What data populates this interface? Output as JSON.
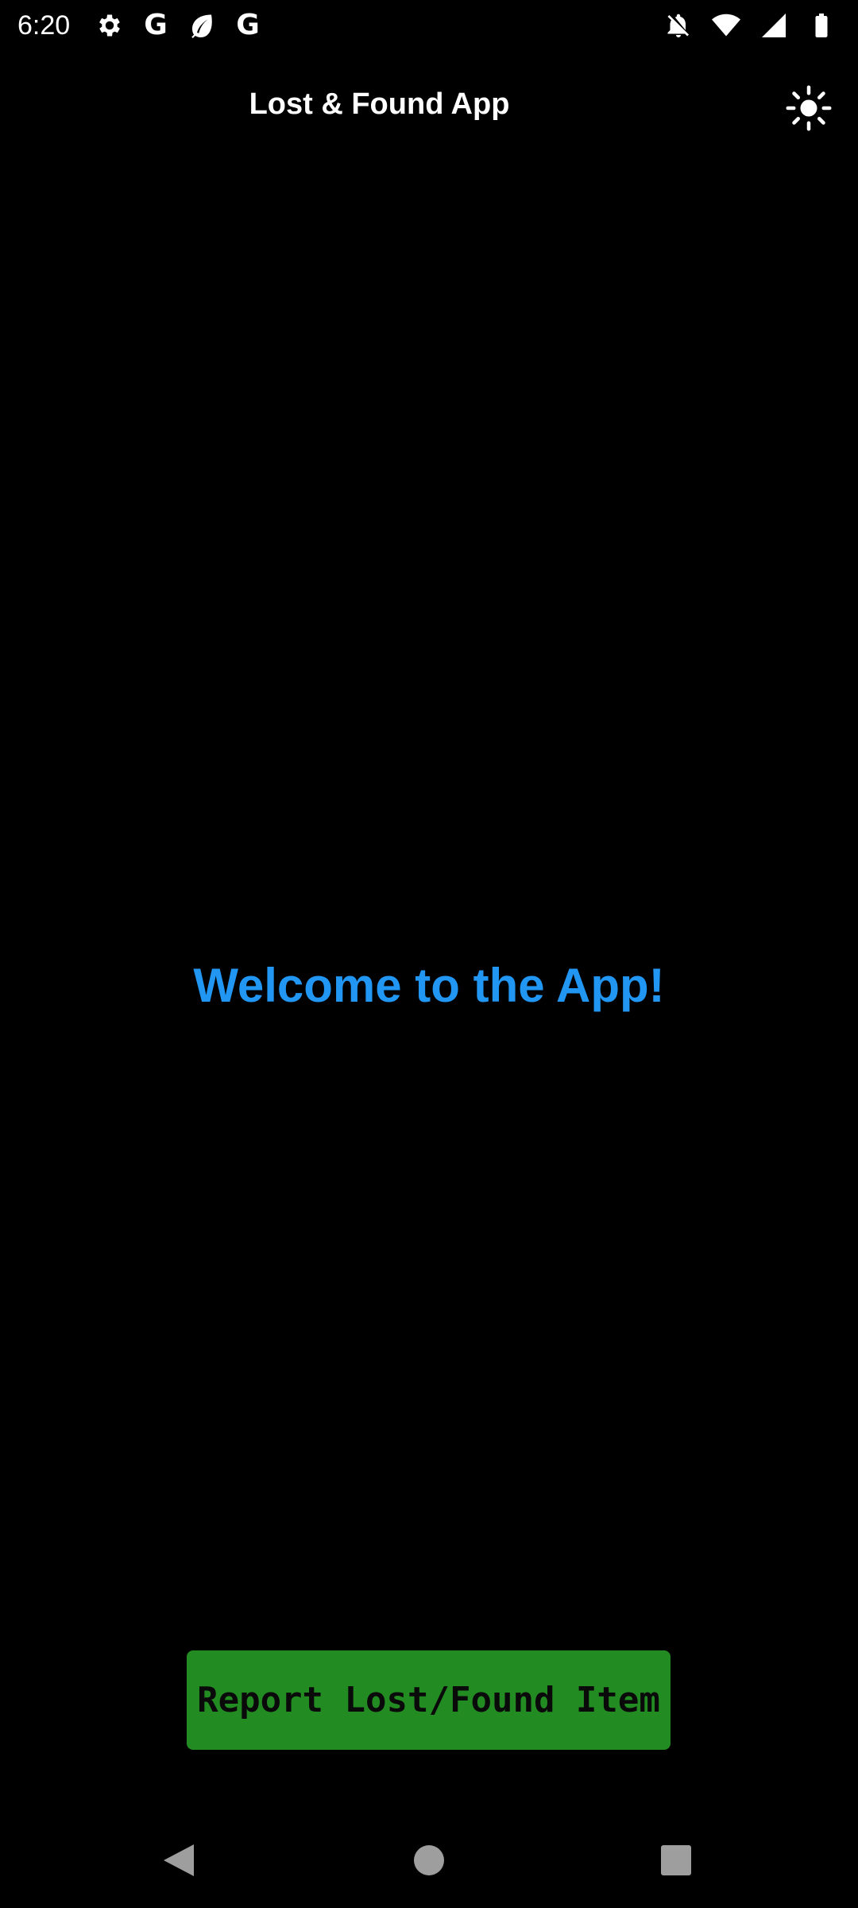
{
  "status_bar": {
    "time": "6:20",
    "left_icons": [
      "settings-icon",
      "google-icon",
      "leaf-icon",
      "google-icon"
    ],
    "right_icons": [
      "notifications-off-icon",
      "wifi-icon",
      "cell-signal-icon",
      "battery-icon"
    ],
    "google_letter": "G"
  },
  "app_bar": {
    "title": "Lost & Found App",
    "theme_toggle_icon": "sun-icon"
  },
  "main": {
    "welcome_text": "Welcome to the App!",
    "report_button_label": "Report Lost/Found Item"
  },
  "nav_bar": {
    "icons": [
      "back-icon",
      "home-icon",
      "recents-icon"
    ]
  },
  "colors": {
    "background": "#000000",
    "welcome_text": "#2196f3",
    "report_button": "#228b22",
    "report_button_text": "#0a0a0a"
  }
}
